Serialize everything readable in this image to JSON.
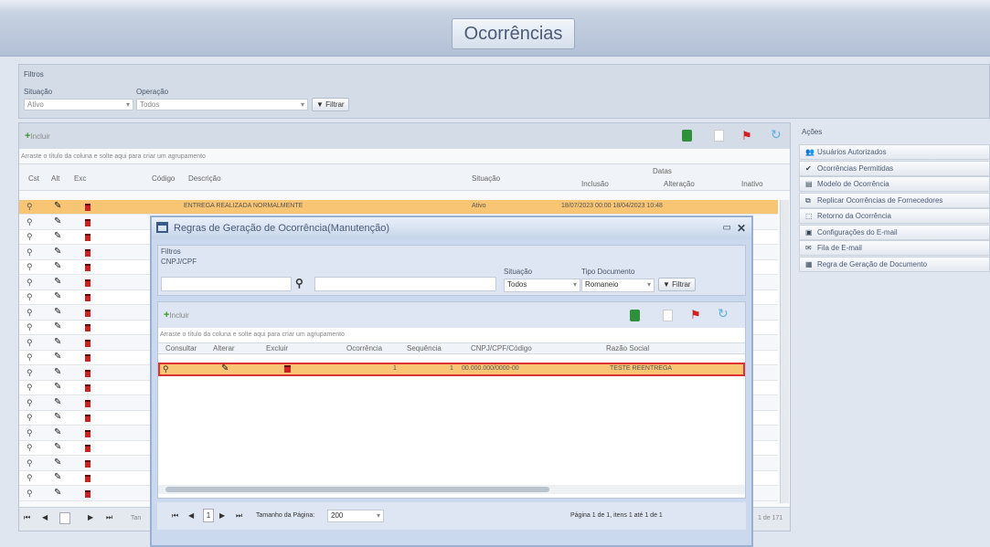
{
  "page_title": "Ocorrências",
  "filters": {
    "section_label": "Filtros",
    "situacao_label": "Situação",
    "situacao_value": "Ativo",
    "operacao_label": "Operação",
    "operacao_value": "Todos",
    "filter_button": "Filtrar"
  },
  "main_grid": {
    "add_label": "Incluir",
    "group_hint": "Arraste o título da coluna e solte aqui para criar um agrupamento",
    "headers": [
      "Cst",
      "Alt",
      "Exc",
      "Código",
      "Descrição",
      "Situação",
      "Datas",
      "Inclusão",
      "Alteração",
      "Inativo"
    ],
    "first_row": {
      "description": "ENTREGA REALIZADA NORMALMENTE",
      "situacao": "Ativo",
      "datas": "18/07/2023 00:00  18/04/2023 10:48"
    },
    "row_count": 20,
    "pager_summary": "1 de 171",
    "pager_prefix": "Tan"
  },
  "actions": {
    "title": "Ações",
    "items": [
      {
        "icon": "users-icon",
        "label": "Usuários Autorizados"
      },
      {
        "icon": "check-icon",
        "label": "Ocorrências Permitidas"
      },
      {
        "icon": "template-icon",
        "label": "Modelo de Ocorrência"
      },
      {
        "icon": "copy-icon",
        "label": "Replicar Ocorrências de Fornecedores"
      },
      {
        "icon": "disk-icon",
        "label": "Retorno da Ocorrência"
      },
      {
        "icon": "email-settings-icon",
        "label": "Configurações do E-mail"
      },
      {
        "icon": "mail-icon",
        "label": "Fila de E-mail"
      },
      {
        "icon": "document-icon",
        "label": "Regra de Geração de Documento"
      }
    ]
  },
  "modal": {
    "title": "Regras de Geração de Ocorrência(Manutenção)",
    "filters_label": "Filtros",
    "cnpj_label": "CNPJ/CPF",
    "situacao_label": "Situação",
    "situacao_value": "Todos",
    "tipo_label": "Tipo Documento",
    "tipo_value": "Romaneio",
    "filter_button": "Filtrar",
    "add_label": "Incluir",
    "group_hint": "Arraste o título da coluna e solte aqui para criar um agrupamento",
    "headers": [
      "Consultar",
      "Alterar",
      "Excluir",
      "Ocorrência",
      "Sequência",
      "CNPJ/CPF/Código",
      "Razão Social"
    ],
    "row": {
      "ocorrencia": "1",
      "sequencia": "1",
      "cnpj": "00.000.000/0000-00",
      "razao": "TESTE REENTREGA"
    },
    "pager_size_label": "Tamanho da Página:",
    "pager_size": "200",
    "page_num": "1",
    "pager_info": "Página 1 de 1, itens 1 até 1 de 1"
  }
}
